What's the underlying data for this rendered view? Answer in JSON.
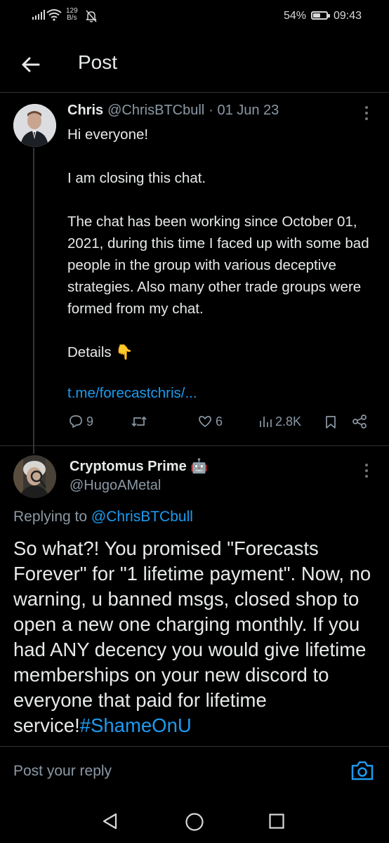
{
  "status_bar": {
    "net_speed_value": "129",
    "net_speed_unit": "B/s",
    "battery_percent": "54%",
    "battery_level": 0.54,
    "time": "09:43"
  },
  "header": {
    "title": "Post"
  },
  "tweet": {
    "author_name": "Chris",
    "author_handle": "@ChrisBTCbull",
    "date": "· 01 Jun 23",
    "body": "Hi everyone!\n\nI am closing this chat.\n\nThe chat has been working since October 01, 2021, during this time I faced up with some bad people in the group with various deceptive strategies. Also many other trade groups were formed from my chat.\n\nDetails 👇",
    "link": "t.me/forecastchris/...",
    "reply_count": "9",
    "retweet_count": "",
    "like_count": "6",
    "view_count": "2.8K"
  },
  "reply": {
    "author_name": "Cryptomus Prime 🤖",
    "author_handle": "@HugoAMetal",
    "replying_prefix": "Replying to",
    "replying_to": "@ChrisBTCbull",
    "body": "So what?! You promised \"Forecasts Forever\" for \"1 lifetime payment\". Now, no warning, u banned msgs, closed shop to open a new one charging monthly. If you had ANY decency you would give lifetime memberships on your new discord to everyone that paid for lifetime service!",
    "hashtag": "#ShameOnU"
  },
  "composer": {
    "placeholder": "Post your reply"
  },
  "icons": {
    "back": "arrow-left-icon",
    "more": "more-vertical-icon",
    "reply": "comment-icon",
    "retweet": "retweet-icon",
    "like": "heart-icon",
    "views": "analytics-icon",
    "bookmark": "bookmark-icon",
    "share": "share-icon",
    "camera": "camera-icon"
  },
  "colors": {
    "background": "#000000",
    "accent": "#1d9bf0",
    "muted": "#8b98a5",
    "text": "#e7e9ea"
  }
}
